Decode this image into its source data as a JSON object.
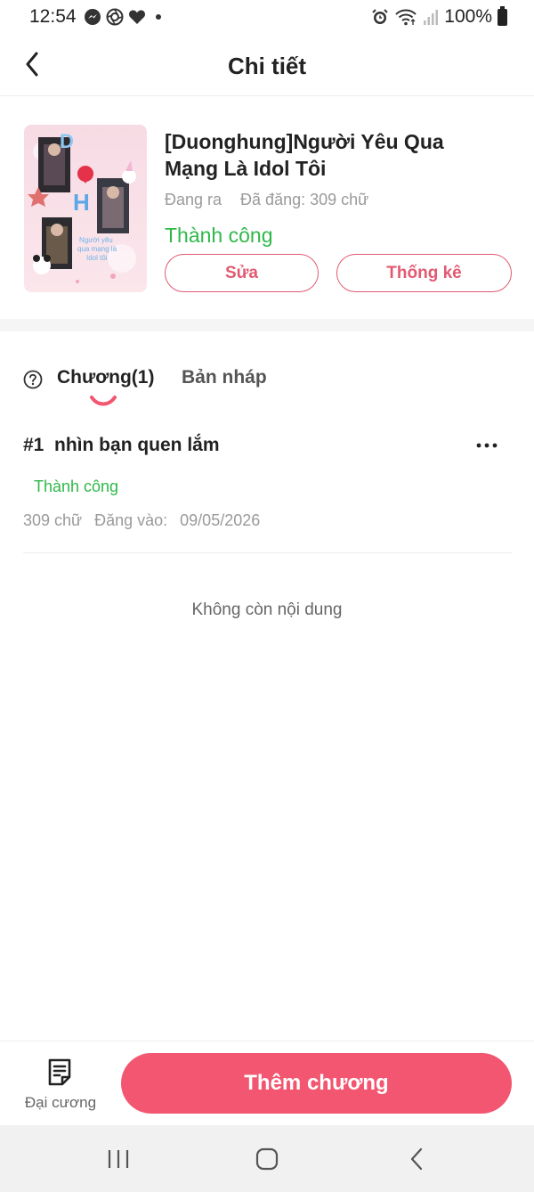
{
  "status_bar": {
    "time": "12:54",
    "battery": "100%",
    "notification_icons": [
      "messenger-icon",
      "camera-icon",
      "heart-icon"
    ],
    "system_icons": [
      "alarm-icon",
      "wifi-icon",
      "signal-icon",
      "battery-icon"
    ]
  },
  "header": {
    "title": "Chi tiết"
  },
  "book": {
    "title": "[Duonghung]Người Yêu Qua Mạng Là Idol Tôi",
    "state": "Đang ra",
    "posted": "Đã đăng: 309 chữ",
    "status": "Thành công",
    "edit_label": "Sửa",
    "stats_label": "Thống kê"
  },
  "tabs": {
    "chapters": "Chương(1)",
    "drafts": "Bản nháp"
  },
  "chapters": [
    {
      "number": "#1",
      "title": "nhìn bạn quen lắm",
      "status": "Thành công",
      "words": "309 chữ",
      "posted_label": "Đăng vào:",
      "date": "09/05/2026"
    }
  ],
  "empty_note": "Không còn nội dung",
  "bottom": {
    "outline_label": "Đại cương",
    "add_chapter_label": "Thêm chương"
  },
  "colors": {
    "accent": "#f35670",
    "outline_accent": "#e15a72",
    "success": "#2fb84a"
  }
}
